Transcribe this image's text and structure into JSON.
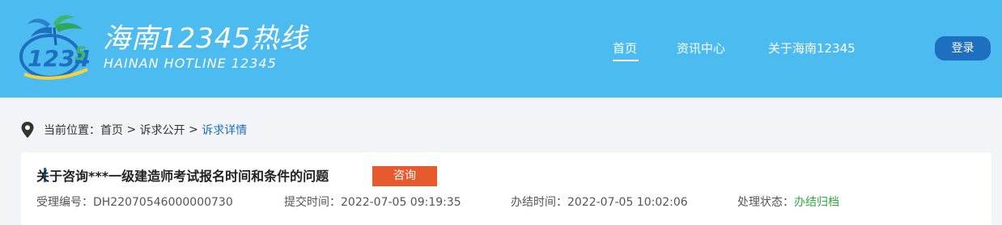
{
  "header": {
    "logo_cn": "海南12345热线",
    "logo_en": "HAINAN HOTLINE 12345",
    "nav": [
      {
        "label": "首页",
        "active": true
      },
      {
        "label": "资讯中心"
      },
      {
        "label": "关于海南12345"
      }
    ],
    "login_label": "登录"
  },
  "breadcrumb": {
    "prefix": "当前位置：",
    "home": "首页",
    "sep": " > ",
    "section": "诉求公开",
    "current": "诉求详情"
  },
  "detail": {
    "title": "关于咨询***一级建造师考试报名时间和条件的问题",
    "tag": "咨询",
    "meta": [
      {
        "label": "受理编号：",
        "value": "DH22070546000000730"
      },
      {
        "label": "提交时间：",
        "value": "2022-07-05 09:19:35"
      },
      {
        "label": "办结时间：",
        "value": "2022-07-05 10:02:06"
      },
      {
        "label": "处理状态：",
        "value": "办结归档"
      }
    ]
  },
  "colors": {
    "header_bg": "#4bbbf0",
    "button_blue": "#1f6fc0",
    "tag_orange": "#e65a2d",
    "status_green": "#2eaa3c"
  }
}
